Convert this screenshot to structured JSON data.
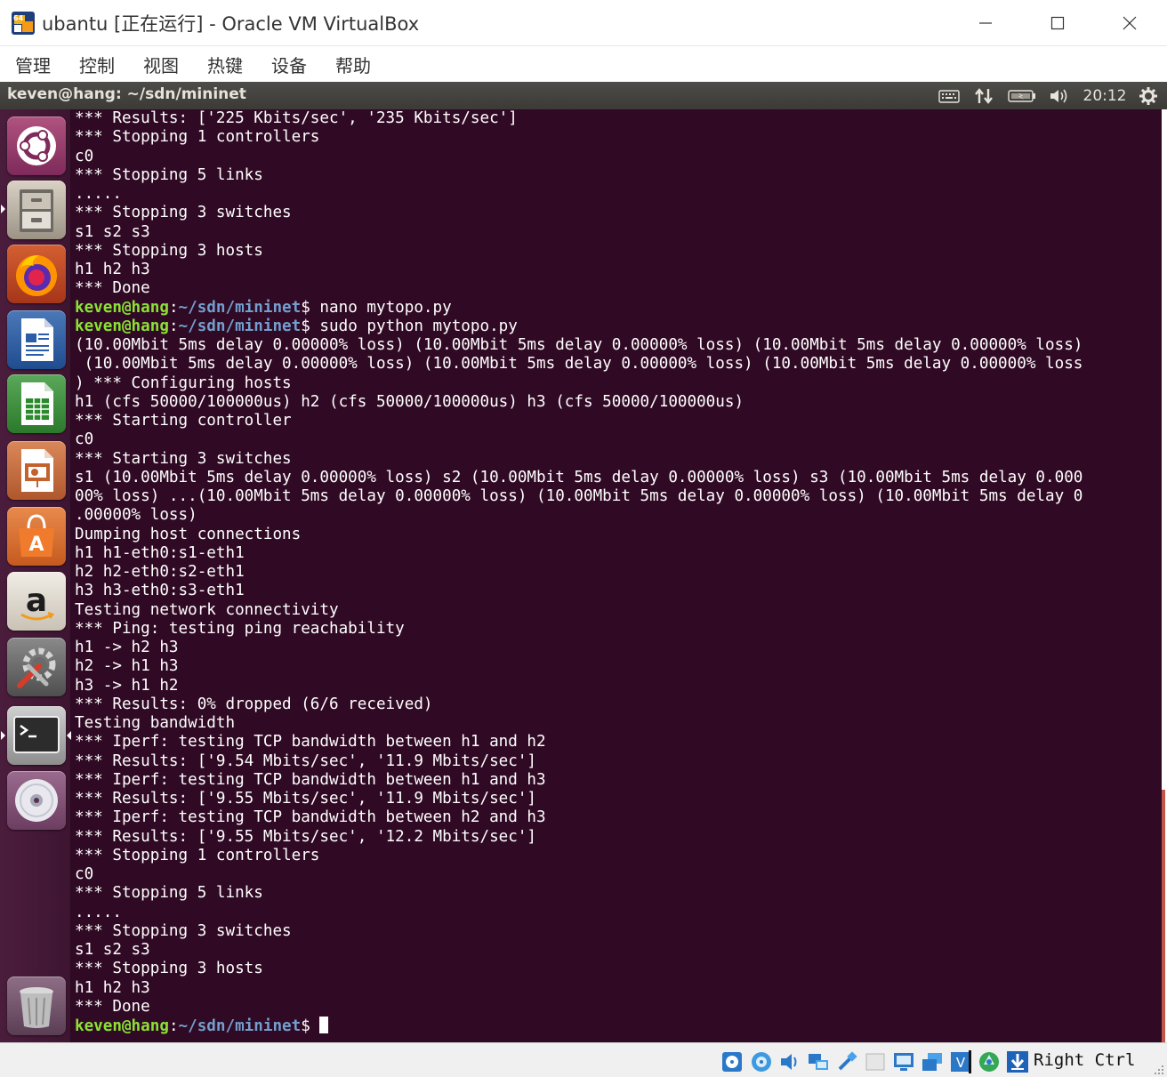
{
  "window": {
    "title": "ubantu [正在运行] - Oracle VM VirtualBox",
    "menu": [
      "管理",
      "控制",
      "视图",
      "热键",
      "设备",
      "帮助"
    ]
  },
  "panel": {
    "title": "keven@hang: ~/sdn/mininet",
    "clock": "20:12"
  },
  "launcher": [
    {
      "name": "dash-home",
      "icon": "ubuntu-logo-icon"
    },
    {
      "name": "files",
      "icon": "file-cabinet-icon",
      "running": true
    },
    {
      "name": "firefox",
      "icon": "firefox-icon"
    },
    {
      "name": "libreoffice-writer",
      "icon": "writer-icon"
    },
    {
      "name": "libreoffice-calc",
      "icon": "calc-icon"
    },
    {
      "name": "libreoffice-impress",
      "icon": "impress-icon"
    },
    {
      "name": "software-center",
      "icon": "shopping-bag-icon"
    },
    {
      "name": "amazon",
      "icon": "amazon-icon"
    },
    {
      "name": "system-settings",
      "icon": "settings-tools-icon"
    },
    {
      "name": "terminal",
      "icon": "terminal-icon",
      "running": true,
      "focused": true
    },
    {
      "name": "dvd",
      "icon": "disc-icon"
    },
    {
      "name": "trash",
      "icon": "trash-icon"
    }
  ],
  "terminal": {
    "user_host": "keven@hang",
    "path": "~/sdn/mininet",
    "lines": [
      {
        "text": "*** Results: ['225 Kbits/sec', '235 Kbits/sec']"
      },
      {
        "text": "*** Stopping 1 controllers"
      },
      {
        "text": "c0"
      },
      {
        "text": "*** Stopping 5 links"
      },
      {
        "text": "....."
      },
      {
        "text": "*** Stopping 3 switches"
      },
      {
        "text": "s1 s2 s3"
      },
      {
        "text": "*** Stopping 3 hosts"
      },
      {
        "text": "h1 h2 h3"
      },
      {
        "text": "*** Done"
      },
      {
        "prompt": true,
        "cmd": " nano mytopo.py"
      },
      {
        "prompt": true,
        "cmd": " sudo python mytopo.py"
      },
      {
        "text": "(10.00Mbit 5ms delay 0.00000% loss) (10.00Mbit 5ms delay 0.00000% loss) (10.00Mbit 5ms delay 0.00000% loss)"
      },
      {
        "text": " (10.00Mbit 5ms delay 0.00000% loss) (10.00Mbit 5ms delay 0.00000% loss) (10.00Mbit 5ms delay 0.00000% loss"
      },
      {
        "text": ") *** Configuring hosts"
      },
      {
        "text": "h1 (cfs 50000/100000us) h2 (cfs 50000/100000us) h3 (cfs 50000/100000us)"
      },
      {
        "text": "*** Starting controller"
      },
      {
        "text": "c0"
      },
      {
        "text": "*** Starting 3 switches"
      },
      {
        "text": "s1 (10.00Mbit 5ms delay 0.00000% loss) s2 (10.00Mbit 5ms delay 0.00000% loss) s3 (10.00Mbit 5ms delay 0.000"
      },
      {
        "text": "00% loss) ...(10.00Mbit 5ms delay 0.00000% loss) (10.00Mbit 5ms delay 0.00000% loss) (10.00Mbit 5ms delay 0"
      },
      {
        "text": ".00000% loss)"
      },
      {
        "text": "Dumping host connections"
      },
      {
        "text": "h1 h1-eth0:s1-eth1"
      },
      {
        "text": "h2 h2-eth0:s2-eth1"
      },
      {
        "text": "h3 h3-eth0:s3-eth1"
      },
      {
        "text": "Testing network connectivity"
      },
      {
        "text": "*** Ping: testing ping reachability"
      },
      {
        "text": "h1 -> h2 h3"
      },
      {
        "text": "h2 -> h1 h3"
      },
      {
        "text": "h3 -> h1 h2"
      },
      {
        "text": "*** Results: 0% dropped (6/6 received)"
      },
      {
        "text": "Testing bandwidth"
      },
      {
        "text": "*** Iperf: testing TCP bandwidth between h1 and h2"
      },
      {
        "text": "*** Results: ['9.54 Mbits/sec', '11.9 Mbits/sec']"
      },
      {
        "text": "*** Iperf: testing TCP bandwidth between h1 and h3"
      },
      {
        "text": "*** Results: ['9.55 Mbits/sec', '11.9 Mbits/sec']"
      },
      {
        "text": "*** Iperf: testing TCP bandwidth between h2 and h3"
      },
      {
        "text": "*** Results: ['9.55 Mbits/sec', '12.2 Mbits/sec']"
      },
      {
        "text": "*** Stopping 1 controllers"
      },
      {
        "text": "c0"
      },
      {
        "text": "*** Stopping 5 links"
      },
      {
        "text": "....."
      },
      {
        "text": "*** Stopping 3 switches"
      },
      {
        "text": "s1 s2 s3"
      },
      {
        "text": "*** Stopping 3 hosts"
      },
      {
        "text": "h1 h2 h3"
      },
      {
        "text": "*** Done"
      },
      {
        "prompt": true,
        "cmd": " ",
        "cursor": true
      }
    ]
  },
  "statusbar": {
    "icons": [
      "hard-disk-icon",
      "optical-drive-icon",
      "audio-icon",
      "network-adapter-icon",
      "usb-icon",
      "shared-folder-icon",
      "display-icon",
      "video-capture-icon",
      "virtualization-icon",
      "mouse-integration-icon",
      "download-arrow-icon"
    ],
    "host_key": "Right Ctrl"
  },
  "colors": {
    "terminal_bg": "#300a24",
    "prompt_user": "#8ae234",
    "prompt_path": "#729fcf",
    "launcher_bg": "#4b1d3c"
  }
}
